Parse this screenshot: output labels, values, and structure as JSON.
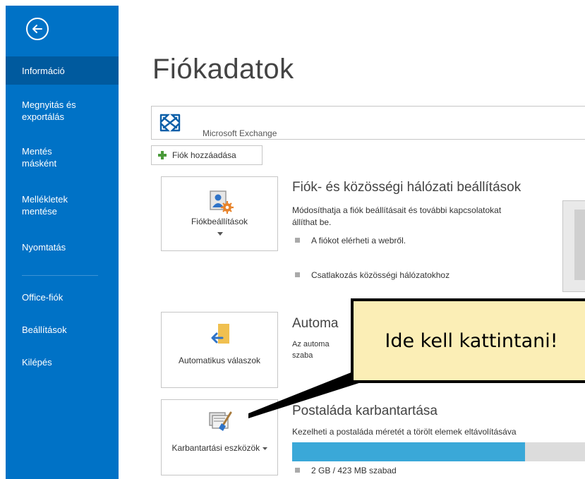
{
  "sidebar": {
    "back_label": "Vissza",
    "items": [
      {
        "label": "Információ",
        "active": true
      },
      {
        "label": "Megnyitás és exportálás"
      },
      {
        "label": "Mentés másként"
      },
      {
        "label": "Mellékletek mentése"
      },
      {
        "label": "Nyomtatás"
      },
      {
        "label": "Office-fiók"
      },
      {
        "label": "Beállítások"
      },
      {
        "label": "Kilépés"
      }
    ]
  },
  "main": {
    "title": "Fiókadatok",
    "account": {
      "name": "Microsoft Exchange",
      "icon": "exchange-icon"
    },
    "add_account_label": "Fiók hozzáadása",
    "sections": {
      "account_settings": {
        "button_label": "Fiókbeállítások",
        "title": "Fiók- és közösségi hálózati beállítások",
        "description": "Módosíthatja a fiók beállításait és további kapcsolatokat állíthat be.",
        "bullets": [
          "A fiókot elérheti a webről.",
          "Csatlakozás közösségi hálózatokhoz"
        ]
      },
      "auto_replies": {
        "button_label": "Automatikus válaszok",
        "title": "Automa",
        "description_lines": [
          "Az automa",
          "szaba"
        ]
      },
      "mailbox_cleanup": {
        "button_label": "Karbantartási eszközök",
        "title": "Postaláda karbantartása",
        "description": "Kezelheti a postaláda méretét a törölt elemek eltávolításáva",
        "quota_text": "2 GB / 423 MB szabad",
        "quota_used_fraction": 0.794
      }
    }
  },
  "callout": {
    "text": "Ide kell kattintani!"
  },
  "colors": {
    "sidebar": "#0072c6",
    "sidebar_active": "#005a9e",
    "callout_bg": "#fbeeb6",
    "quota_fill": "#3aa8d8"
  }
}
